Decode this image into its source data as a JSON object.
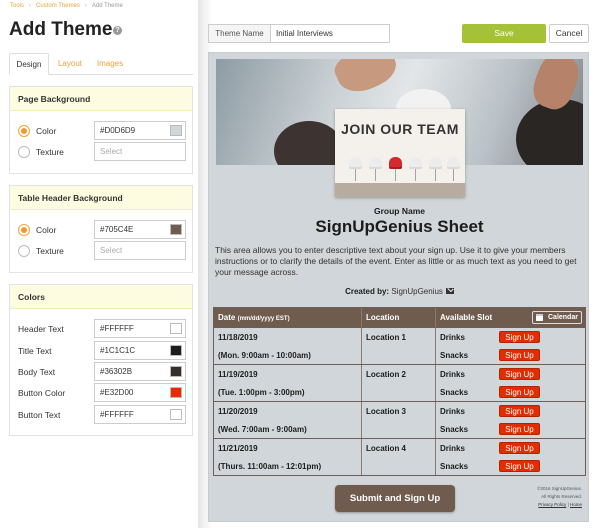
{
  "breadcrumb": [
    "Tools",
    "Custom Themes",
    "Add Theme"
  ],
  "page_title": "Add Theme",
  "help_icon_glyph": "?",
  "tabs": [
    {
      "label": "Design"
    },
    {
      "label": "Layout"
    },
    {
      "label": "Images"
    }
  ],
  "page_background": {
    "title": "Page Background",
    "color_label": "Color",
    "color_value": "#D0D6D9",
    "texture_label": "Texture",
    "texture_placeholder": "Select"
  },
  "table_header_background": {
    "title": "Table Header Background",
    "color_label": "Color",
    "color_value": "#705C4E",
    "texture_label": "Texture",
    "texture_placeholder": "Select"
  },
  "colors": {
    "title": "Colors",
    "items": [
      {
        "label": "Header Text",
        "value": "#FFFFFF"
      },
      {
        "label": "Title Text",
        "value": "#1C1C1C"
      },
      {
        "label": "Body Text",
        "value": "#36302B"
      },
      {
        "label": "Button Color",
        "value": "#E32D00"
      },
      {
        "label": "Button Text",
        "value": "#FFFFFF"
      }
    ]
  },
  "theme_name": {
    "label": "Theme Name",
    "value": "Initial Interviews"
  },
  "actions": {
    "save": "Save",
    "cancel": "Cancel"
  },
  "accent_colors": {
    "save": "#A5C137",
    "tab_link": "#E8A33A",
    "panel_header": "#FDFCE0"
  },
  "preview": {
    "hero_text": "JOIN OUR TEAM",
    "group_name": "Group Name",
    "title": "SignUpGenius Sheet",
    "description": "This area allows you to enter descriptive text about your sign up. Use it to give your members instructions or to clarify the details of the event. Enter as little or as much text as you need to get your message across.",
    "created_by_label": "Created by:",
    "created_by_value": "SignUpGenius",
    "table": {
      "headers": {
        "date": "Date",
        "date_format": "(mm/dd/yyyy EST)",
        "location": "Location",
        "slot": "Available Slot",
        "calendar": "Calendar"
      },
      "rows": [
        {
          "date": "11/18/2019",
          "time": "(Mon. 9:00am - 10:00am)",
          "location": "Location 1",
          "slots": [
            "Drinks",
            "Snacks"
          ]
        },
        {
          "date": "11/19/2019",
          "time": "(Tue. 1:00pm - 3:00pm)",
          "location": "Location 2",
          "slots": [
            "Drinks",
            "Snacks"
          ]
        },
        {
          "date": "11/20/2019",
          "time": "(Wed. 7:00am - 9:00am)",
          "location": "Location 3",
          "slots": [
            "Drinks",
            "Snacks"
          ]
        },
        {
          "date": "11/21/2019",
          "time": "(Thurs. 11:00am - 12:01pm)",
          "location": "Location 4",
          "slots": [
            "Drinks",
            "Snacks"
          ]
        }
      ],
      "sign_up_label": "Sign Up"
    },
    "submit": "Submit and Sign Up",
    "copyright": "©2016 SignUpGenius.",
    "rights": "All Rights Reserved.",
    "privacy": "Privacy Policy",
    "home": "Home"
  }
}
